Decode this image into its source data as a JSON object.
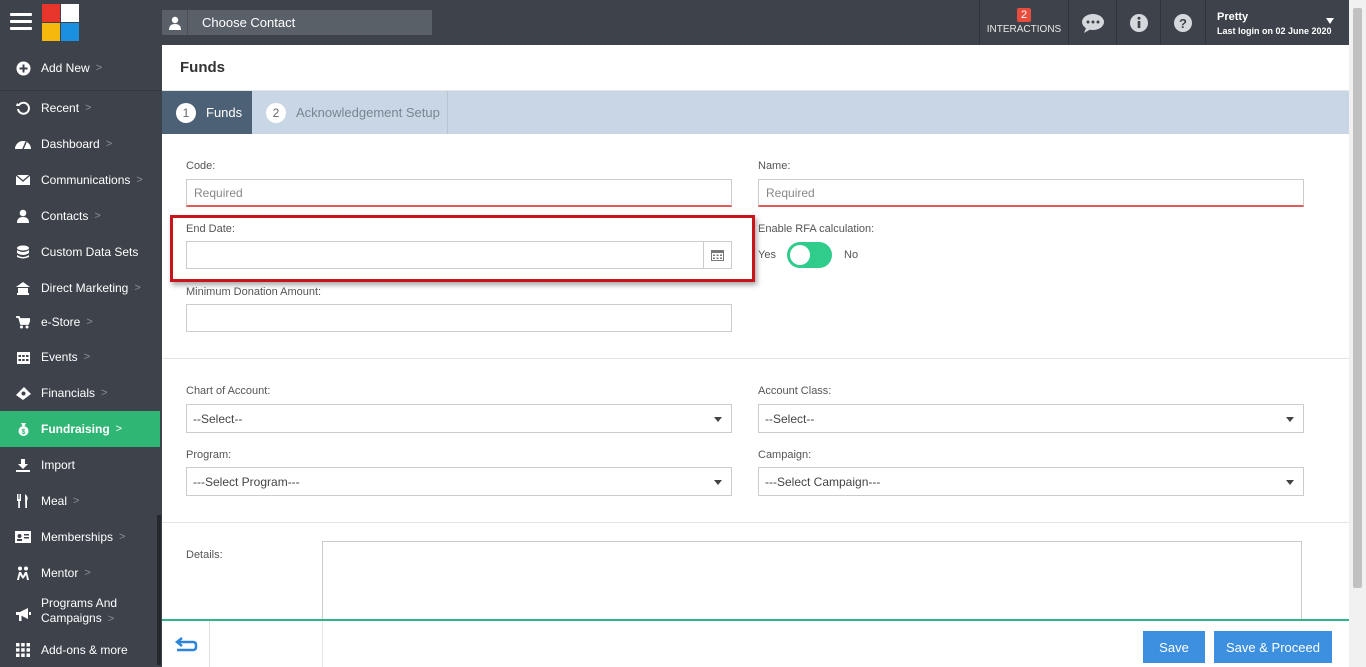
{
  "topbar": {
    "contact_label": "Choose Contact",
    "interactions_count": "2",
    "interactions_label": "INTERACTIONS",
    "user_name": "Pretty",
    "last_login": "Last login on 02 June 2020"
  },
  "sidebar": {
    "items": [
      {
        "label": "Add New",
        "icon": "plus-circle-icon"
      },
      {
        "label": "Recent",
        "icon": "history-icon"
      },
      {
        "label": "Dashboard",
        "icon": "dashboard-icon"
      },
      {
        "label": "Communications",
        "icon": "envelope-icon"
      },
      {
        "label": "Contacts",
        "icon": "user-icon"
      },
      {
        "label": "Custom Data Sets",
        "icon": "database-icon"
      },
      {
        "label": "Direct Marketing",
        "icon": "bank-icon"
      },
      {
        "label": "e-Store",
        "icon": "cart-icon"
      },
      {
        "label": "Events",
        "icon": "calendar-icon"
      },
      {
        "label": "Financials",
        "icon": "money-icon"
      },
      {
        "label": "Fundraising",
        "icon": "moneybag-icon"
      },
      {
        "label": "Import",
        "icon": "download-icon"
      },
      {
        "label": "Meal",
        "icon": "cutlery-icon"
      },
      {
        "label": "Memberships",
        "icon": "id-card-icon"
      },
      {
        "label": "Mentor",
        "icon": "people-icon"
      },
      {
        "label": "Programs And",
        "label2": "Campaigns",
        "icon": "bullhorn-icon"
      },
      {
        "label": "Add-ons & more",
        "icon": "grid-icon"
      }
    ],
    "chevron": ">",
    "active": "Fundraising"
  },
  "page": {
    "title": "Funds",
    "tabs": [
      {
        "num": "1",
        "label": "Funds"
      },
      {
        "num": "2",
        "label": "Acknowledgement Setup"
      }
    ]
  },
  "form": {
    "code_label": "Code:",
    "code_placeholder": "Required",
    "name_label": "Name:",
    "name_placeholder": "Required",
    "end_date_label": "End Date:",
    "end_date_value": "",
    "rfa_label": "Enable RFA calculation:",
    "rfa_yes": "Yes",
    "rfa_no": "No",
    "min_donation_label": "Minimum Donation Amount:",
    "min_donation_value": "",
    "chart_of_account_label": "Chart of Account:",
    "chart_of_account_value": "--Select--",
    "account_class_label": "Account Class:",
    "account_class_value": "--Select--",
    "program_label": "Program:",
    "program_value": "---Select Program---",
    "campaign_label": "Campaign:",
    "campaign_value": "---Select Campaign---",
    "details_label": "Details:"
  },
  "footer": {
    "save_label": "Save",
    "save_proceed_label": "Save & Proceed"
  },
  "colors": {
    "sidebar_bg": "#3e434b",
    "active_green": "#2fb574",
    "button_blue": "#3d8fe0",
    "highlight_red": "#c8151b"
  }
}
